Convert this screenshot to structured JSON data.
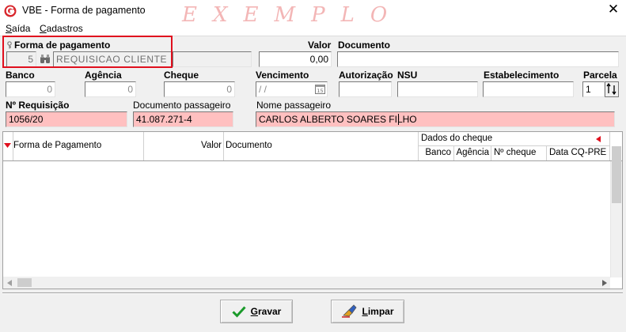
{
  "window": {
    "title": "VBE - Forma de pagamento",
    "watermark": "EXEMPLO",
    "close_glyph": "✕",
    "icon": "app-logo-icon"
  },
  "menu": {
    "items": [
      {
        "accel": "S",
        "rest": "aída"
      },
      {
        "accel": "C",
        "rest": "adastros"
      }
    ]
  },
  "payment": {
    "forma_label": "Forma de pagamento",
    "forma_code": "5",
    "forma_name": "REQUISICAO CLIENTE",
    "valor_label": "Valor",
    "valor_value": "0,00",
    "documento_label": "Documento",
    "documento_value": ""
  },
  "bank": {
    "banco_label": "Banco",
    "banco_value": "0",
    "agencia_label": "Agência",
    "agencia_value": "0",
    "cheque_label": "Cheque",
    "cheque_value": "0",
    "vencimento_label": "Vencimento",
    "vencimento_value": " / /",
    "autorizacao_label": "Autorização",
    "autorizacao_value": "",
    "nsu_label": "NSU",
    "nsu_value": "",
    "estabelecimento_label": "Estabelecimento",
    "estabelecimento_value": "",
    "parcela_label": "Parcela",
    "parcela_value": "1"
  },
  "requisicao": {
    "numero_label": "Nº Requisição",
    "numero_value": "1056/20",
    "doc_label": "Documento passageiro",
    "doc_value": "41.087.271-4",
    "nome_label": "Nome passageiro",
    "nome_value": "CARLOS ALBERTO SOARES FILHO"
  },
  "grid": {
    "columns": {
      "forma": "Forma de Pagamento",
      "valor": "Valor",
      "documento": "Documento",
      "dados_cheque": "Dados do cheque",
      "banco": "Banco",
      "agencia": "Agência",
      "numero_cheque": "Nº cheque",
      "data": "Data CQ-PRE"
    },
    "rows": []
  },
  "buttons": {
    "gravar": {
      "accel": "G",
      "rest": "ravar"
    },
    "limpar": {
      "accel": "L",
      "rest": "impar"
    }
  },
  "colors": {
    "accent_red": "#e0101e",
    "required_field": "#ffc0c0",
    "watermark": "#f3b6b6"
  }
}
